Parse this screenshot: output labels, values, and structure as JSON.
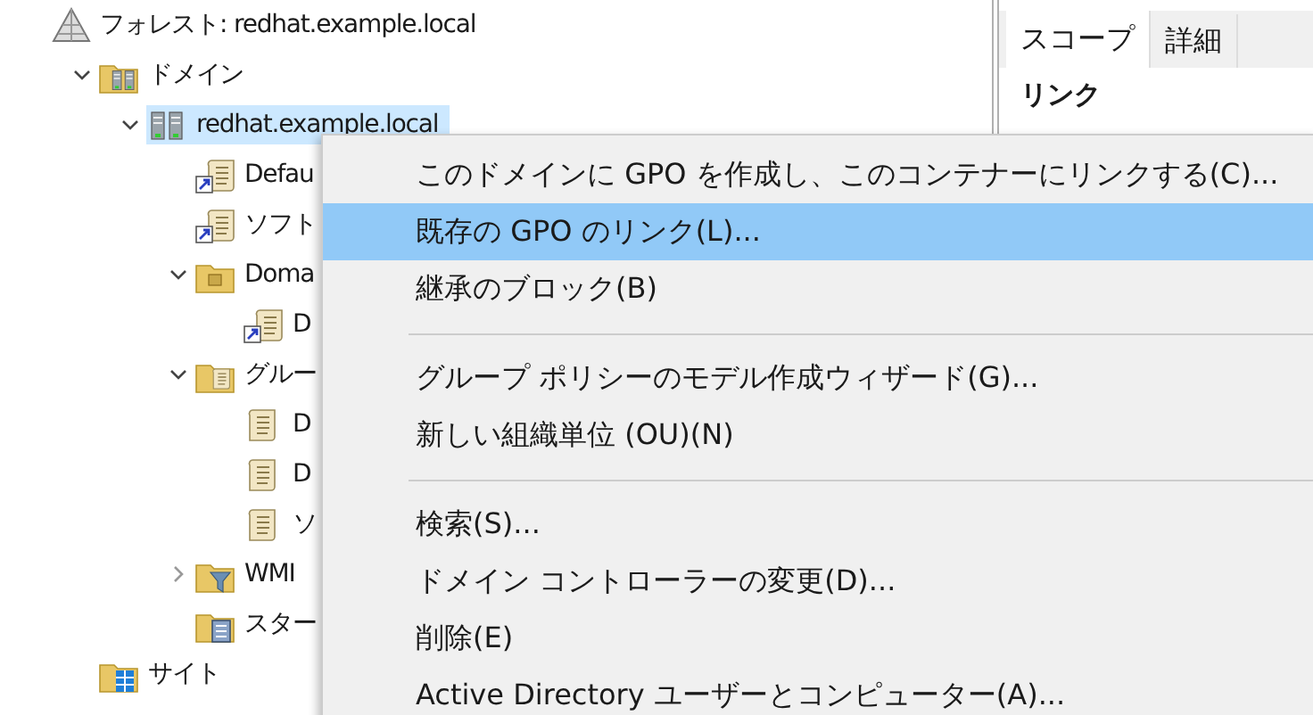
{
  "tree": [
    {
      "label": "フォレスト: redhat.example.local",
      "kind": "forest",
      "selected": false,
      "children": [
        {
          "label": "ドメイン",
          "kind": "domains",
          "expanded": true,
          "selected": false,
          "children": [
            {
              "label": "redhat.example.local",
              "kind": "domain",
              "expanded": true,
              "selected": true,
              "children": [
                {
                  "label": "Defau",
                  "kind": "gpo-link",
                  "selected": false
                },
                {
                  "label": "ソフト",
                  "kind": "gpo-link",
                  "selected": false
                },
                {
                  "label": "Doma",
                  "kind": "ou",
                  "expanded": true,
                  "selected": false,
                  "children": [
                    {
                      "label": "D",
                      "kind": "gpo-link",
                      "selected": false
                    }
                  ]
                },
                {
                  "label": "グルー",
                  "kind": "gpo-folder",
                  "expanded": true,
                  "selected": false,
                  "children": [
                    {
                      "label": "D",
                      "kind": "gpo",
                      "selected": false
                    },
                    {
                      "label": "D",
                      "kind": "gpo",
                      "selected": false
                    },
                    {
                      "label": "ソ",
                      "kind": "gpo",
                      "selected": false
                    }
                  ]
                },
                {
                  "label": "WMI",
                  "kind": "wmi",
                  "expanded": false,
                  "selected": false
                },
                {
                  "label": "スター",
                  "kind": "starter",
                  "selected": false
                }
              ]
            }
          ]
        },
        {
          "label": "サイト",
          "kind": "sites",
          "selected": false
        }
      ]
    }
  ],
  "right_pane": {
    "tabs": [
      {
        "label": "スコープ",
        "selected": true
      },
      {
        "label": "詳細",
        "selected": false
      }
    ],
    "heading": "リンク"
  },
  "context_menu": [
    {
      "kind": "item",
      "label": "このドメインに GPO を作成し、このコンテナーにリンクする(C)...",
      "selected": false
    },
    {
      "kind": "item",
      "label": "既存の GPO のリンク(L)...",
      "selected": true
    },
    {
      "kind": "item",
      "label": "継承のブロック(B)",
      "selected": false
    },
    {
      "kind": "separator"
    },
    {
      "kind": "item",
      "label": "グループ ポリシーのモデル作成ウィザード(G)...",
      "selected": false
    },
    {
      "kind": "item",
      "label": "新しい組織単位 (OU)(N)",
      "selected": false
    },
    {
      "kind": "separator"
    },
    {
      "kind": "item",
      "label": "検索(S)...",
      "selected": false
    },
    {
      "kind": "item",
      "label": "ドメイン コントローラーの変更(D)...",
      "selected": false
    },
    {
      "kind": "item",
      "label": "削除(E)",
      "selected": false
    },
    {
      "kind": "item",
      "label": "Active Directory ユーザーとコンピューター(A)...",
      "selected": false
    }
  ]
}
